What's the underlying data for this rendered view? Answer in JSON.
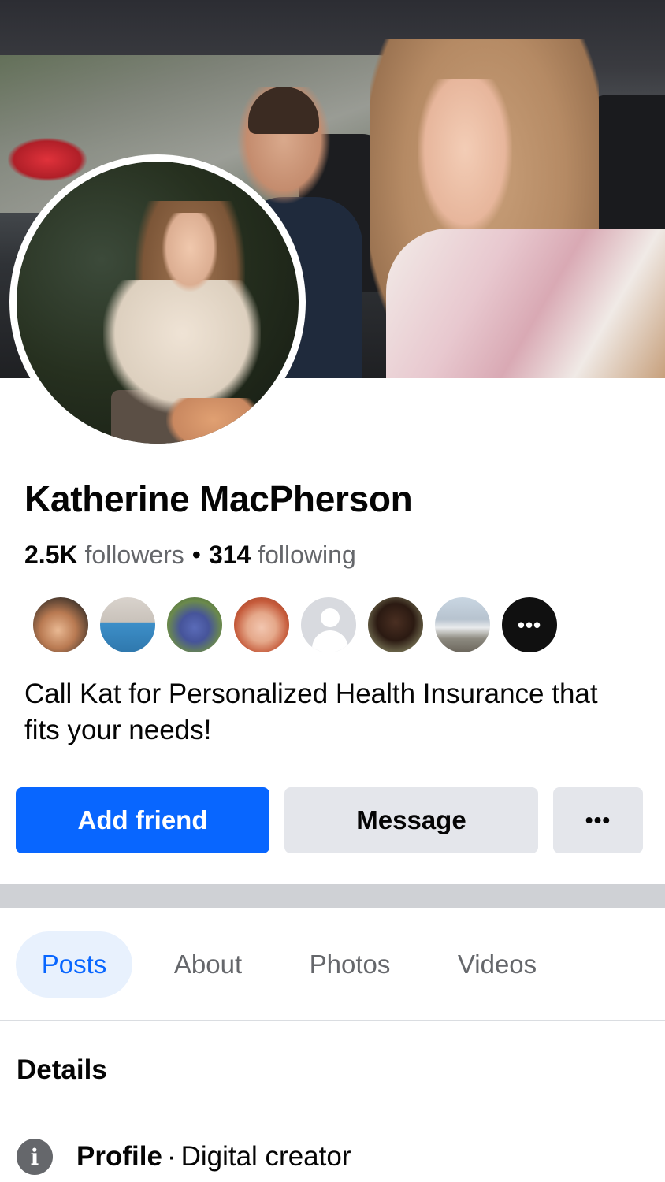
{
  "profile": {
    "name": "Katherine MacPherson",
    "followers_count": "2.5K",
    "followers_label": "followers",
    "following_count": "314",
    "following_label": "following",
    "bio": "Call Kat for Personalized Health Insurance that fits your needs!"
  },
  "friends": {
    "more_label": "•••"
  },
  "actions": {
    "add_friend": "Add friend",
    "message": "Message",
    "more": "•••"
  },
  "tabs": [
    {
      "label": "Posts",
      "active": true
    },
    {
      "label": "About",
      "active": false
    },
    {
      "label": "Photos",
      "active": false
    },
    {
      "label": "Videos",
      "active": false
    }
  ],
  "details": {
    "title": "Details",
    "rows": [
      {
        "icon": "info-icon",
        "label": "Profile",
        "separator": "·",
        "value": "Digital creator"
      }
    ]
  },
  "colors": {
    "accent": "#0866ff",
    "secondary_button": "#e4e6eb",
    "muted_text": "#65676b",
    "active_tab_bg": "#e8f1fd"
  }
}
